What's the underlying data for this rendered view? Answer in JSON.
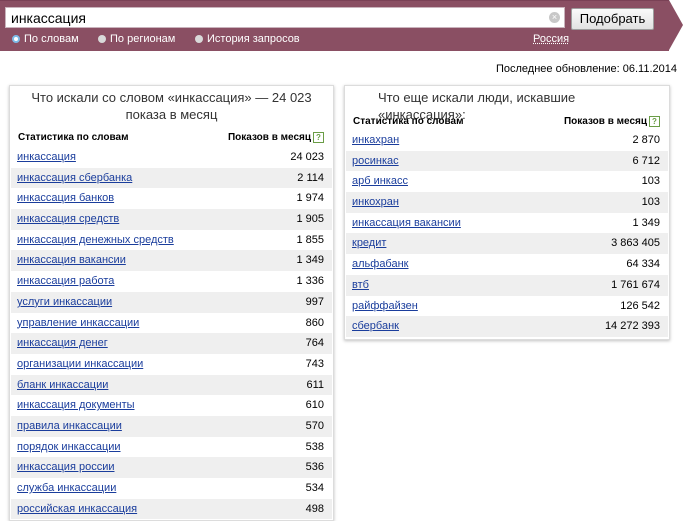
{
  "search": {
    "query": "инкассация",
    "clear_symbol": "×",
    "submit_label": "Подобрать"
  },
  "modes": {
    "by_words": "По словам",
    "by_regions": "По регионам",
    "history": "История запросов"
  },
  "region": "Россия",
  "last_update": "Последнее обновление: 06.11.2014",
  "left_panel": {
    "title": "Что искали со словом «инкассация» — 24 023 показа в месяц",
    "col_keyword": "Статистика по словам",
    "col_count": "Показов в месяц",
    "help_symbol": "?",
    "rows": [
      {
        "keyword": "инкассация",
        "count": "24 023"
      },
      {
        "keyword": "инкассация сбербанка",
        "count": "2 114"
      },
      {
        "keyword": "инкассация банков",
        "count": "1 974"
      },
      {
        "keyword": "инкассация средств",
        "count": "1 905"
      },
      {
        "keyword": "инкассация денежных средств",
        "count": "1 855"
      },
      {
        "keyword": "инкассация вакансии",
        "count": "1 349"
      },
      {
        "keyword": "инкассация работа",
        "count": "1 336"
      },
      {
        "keyword": "услуги инкассации",
        "count": "997"
      },
      {
        "keyword": "управление инкассации",
        "count": "860"
      },
      {
        "keyword": "инкассация денег",
        "count": "764"
      },
      {
        "keyword": "организации инкассации",
        "count": "743"
      },
      {
        "keyword": "бланк инкассации",
        "count": "611"
      },
      {
        "keyword": "инкассация документы",
        "count": "610"
      },
      {
        "keyword": "правила инкассации",
        "count": "570"
      },
      {
        "keyword": "порядок инкассации",
        "count": "538"
      },
      {
        "keyword": "инкассация россии",
        "count": "536"
      },
      {
        "keyword": "служба инкассации",
        "count": "534"
      },
      {
        "keyword": "российская инкассация",
        "count": "498"
      }
    ]
  },
  "right_panel": {
    "title": "Что еще искали люди, искавшие «инкассация»:",
    "col_keyword": "Статистика по словам",
    "col_count": "Показов в месяц",
    "help_symbol": "?",
    "rows": [
      {
        "keyword": "инкахран",
        "count": "2 870"
      },
      {
        "keyword": "росинкас",
        "count": "6 712"
      },
      {
        "keyword": "арб инкасс",
        "count": "103"
      },
      {
        "keyword": "инкохран",
        "count": "103"
      },
      {
        "keyword": "инкассация вакансии",
        "count": "1 349"
      },
      {
        "keyword": "кредит",
        "count": "3 863 405"
      },
      {
        "keyword": "альфабанк",
        "count": "64 334"
      },
      {
        "keyword": "втб",
        "count": "1 761 674"
      },
      {
        "keyword": "райффайзен",
        "count": "126 542"
      },
      {
        "keyword": "сбербанк",
        "count": "14 272 393"
      }
    ]
  }
}
